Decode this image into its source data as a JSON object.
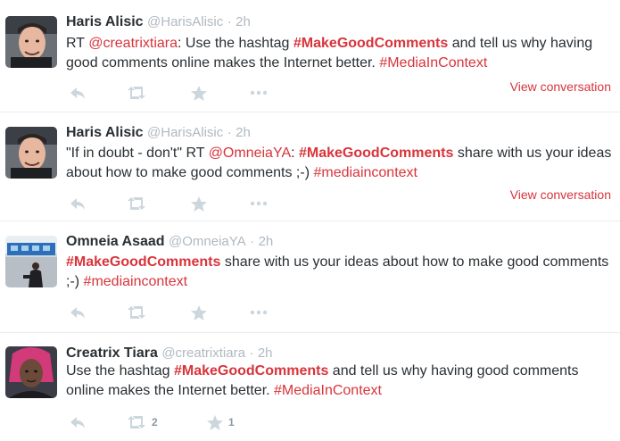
{
  "tweets": [
    {
      "name": "Haris Alisic",
      "handle": "@HarisAlisic",
      "dot": "·",
      "time": "2h",
      "body": [
        {
          "t": "RT ",
          "c": "text"
        },
        {
          "t": "@creatrixtiara",
          "c": "mention"
        },
        {
          "t": ": Use the hashtag ",
          "c": "text"
        },
        {
          "t": "#MakeGoodComments",
          "c": "hashtag-bold"
        },
        {
          "t": " and tell us why having good comments online makes the Internet better. ",
          "c": "text"
        },
        {
          "t": "#MediaInContext",
          "c": "hashtag"
        }
      ],
      "view_conversation": "View conversation",
      "retweet_count": "",
      "favorite_count": ""
    },
    {
      "name": "Haris Alisic",
      "handle": "@HarisAlisic",
      "dot": "·",
      "time": "2h",
      "body": [
        {
          "t": "\"If in doubt - don't\" RT ",
          "c": "text"
        },
        {
          "t": "@OmneiaYA",
          "c": "mention"
        },
        {
          "t": ": ",
          "c": "text"
        },
        {
          "t": "#MakeGoodComments",
          "c": "hashtag-bold"
        },
        {
          "t": " share with us your ideas about how to make good comments ;-) ",
          "c": "text"
        },
        {
          "t": "#mediaincontext",
          "c": "hashtag"
        }
      ],
      "view_conversation": "View conversation",
      "retweet_count": "",
      "favorite_count": ""
    },
    {
      "name": "Omneia Asaad",
      "handle": "@OmneiaYA",
      "dot": "·",
      "time": "2h",
      "body": [
        {
          "t": "#MakeGoodComments",
          "c": "hashtag-bold"
        },
        {
          "t": " share with us your ideas about how to make good comments ;-) ",
          "c": "text"
        },
        {
          "t": "#mediaincontext",
          "c": "hashtag"
        }
      ],
      "view_conversation": "",
      "retweet_count": "",
      "favorite_count": ""
    },
    {
      "name": "Creatrix Tiara",
      "handle": "@creatrixtiara",
      "dot": "·",
      "time": "2h",
      "body": [
        {
          "t": "Use the hashtag ",
          "c": "text"
        },
        {
          "t": "#MakeGoodComments",
          "c": "hashtag-bold"
        },
        {
          "t": " and tell us why having good comments online makes the Internet better. ",
          "c": "text"
        },
        {
          "t": "#MediaInContext",
          "c": "hashtag"
        }
      ],
      "view_conversation": "",
      "retweet_count": "2",
      "favorite_count": "1"
    }
  ],
  "icons": {
    "reply": "reply-icon",
    "retweet": "retweet-icon",
    "favorite": "star-icon",
    "more": "more-icon"
  },
  "colors": {
    "accent": "#d8343b",
    "muted": "#b0b9c1",
    "icon": "#ccd6dd",
    "divider": "#e8ecee"
  }
}
